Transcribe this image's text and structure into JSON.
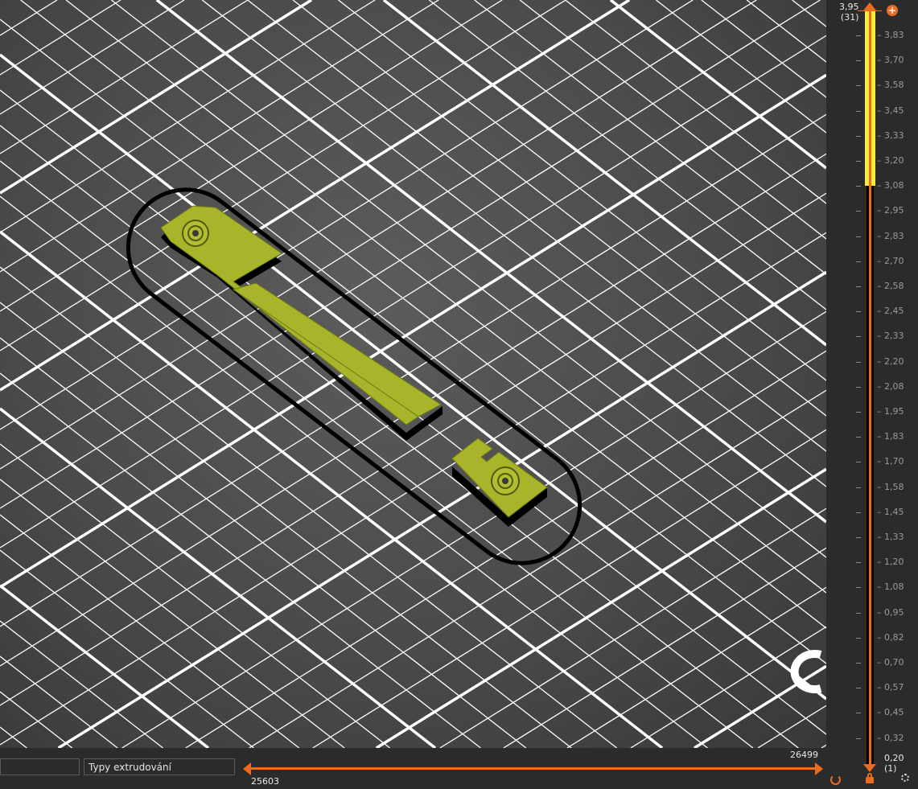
{
  "vertical_slider": {
    "top_value": "3,95",
    "top_layer": "(31)",
    "bottom_value": "0,20",
    "bottom_layer": "(1)",
    "ticks": [
      "3,83",
      "3,70",
      "3,58",
      "3,45",
      "3,33",
      "3,20",
      "3,08",
      "2,95",
      "2,83",
      "2,70",
      "2,58",
      "2,45",
      "2,33",
      "2,20",
      "2,08",
      "1,95",
      "1,83",
      "1,70",
      "1,58",
      "1,45",
      "1,33",
      "1,20",
      "1,08",
      "0,95",
      "0,82",
      "0,70",
      "0,57",
      "0,45",
      "0,32"
    ],
    "highlight_lower_value": "3,08"
  },
  "horizontal_slider": {
    "left_value": "25603",
    "right_value": "26499"
  },
  "bottom_bar": {
    "view_type_select": "Typy extrudování",
    "left_field": ""
  },
  "colors": {
    "accent": "#ed6b21",
    "extrusion": "#a8b42a",
    "highlight": "#f4f03a"
  }
}
